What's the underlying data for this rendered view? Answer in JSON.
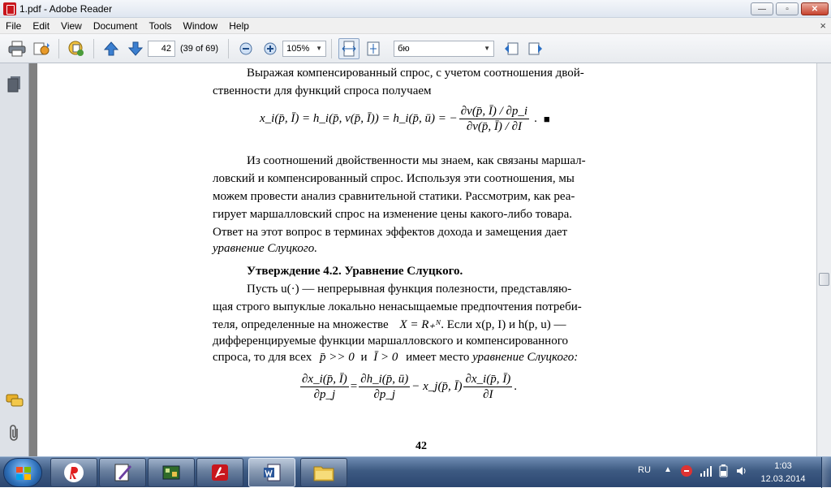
{
  "window": {
    "title": "1.pdf - Adobe Reader",
    "close_label": "✕",
    "min_label": "—",
    "max_label": "▫"
  },
  "menu": {
    "items": [
      "File",
      "Edit",
      "View",
      "Document",
      "Tools",
      "Window",
      "Help"
    ],
    "close": "×"
  },
  "toolbar": {
    "page_number": "42",
    "page_count": "(39 of 69)",
    "zoom": "105%",
    "search_text": "бю"
  },
  "document": {
    "line1": "Выражая компенсированный спрос, с учетом соотношения двой-",
    "line2": "ственности для функций спроса получаем",
    "formula1_lhs": "x",
    "formula1_text": "x_i(p̄, Ī) = h_i(p̄, v(p̄, Ī)) = h_i(p̄, ū) = −",
    "formula1_num": "∂v(p̄, Ī) / ∂p_i",
    "formula1_den": "∂v(p̄, Ī) / ∂I",
    "qed": "■",
    "para2": [
      "Из соотношений двойственности мы знаем, как связаны маршал-",
      "ловский и компенсированный спрос. Используя эти соотношения, мы",
      "можем провести анализ сравнительной статики. Рассмотрим, как реа-",
      "гирует маршалловский спрос на изменение цены какого-либо товара.",
      "Ответ на этот вопрос в терминах эффектов дохода и замещения дает"
    ],
    "para2_last": "уравнение Слуцкого.",
    "heading": "Утверждение 4.2. Уравнение Слуцкого.",
    "para3_l1": "Пусть u(·) — непрерывная функция полезности, представляю-",
    "para3_l2": "щая строго выпуклые локально ненасыщаемые предпочтения потреби-",
    "para3_l3a": "теля, определенные на множестве",
    "para3_l3b": "X = R₊ᴺ",
    "para3_l3c": ". Если  x(p, I)  и  h(p, u) —",
    "para3_l4": "дифференцируемые функции маршалловского и компенсированного",
    "para3_l5a": "спроса, то для всех",
    "para3_l5b": "p̄ >> 0",
    "para3_l5c": "и",
    "para3_l5d": "Ī > 0",
    "para3_l5e": "имеет место",
    "para3_l5f": "уравнение Слуцкого:",
    "f2_n1": "∂x_i(p̄, Ī)",
    "f2_d1": "∂p_j",
    "f2_eq": "=",
    "f2_n2": "∂h_i(p̄, ū)",
    "f2_d2": "∂p_j",
    "f2_mid": "− x_j(p̄, Ī)",
    "f2_n3": "∂x_i(p̄, Ī)",
    "f2_d3": "∂I",
    "f2_end": ".",
    "page_footer": "42"
  },
  "taskbar": {
    "lang": "RU",
    "time": "1:03",
    "date": "12.03.2014",
    "tray_arrow": "▲"
  },
  "colors": {
    "accent": "#c8161d",
    "taskbar": "#3d5a82"
  }
}
